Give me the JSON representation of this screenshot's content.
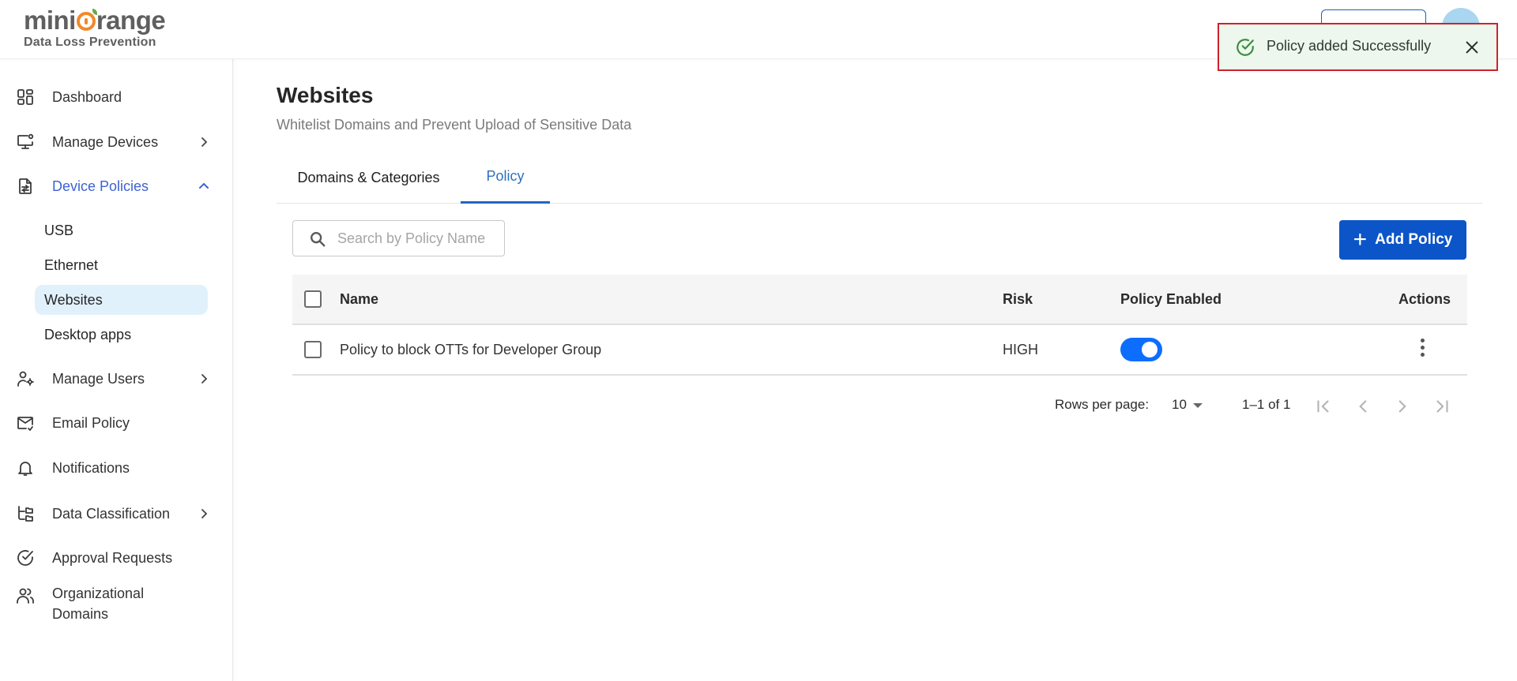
{
  "app": {
    "brand_name_pre": "mini",
    "brand_name_post": "range",
    "brand_subtitle": "Data Loss Prevention",
    "accent_color": "#0c55c8",
    "active_nav_color": "#3d63d2"
  },
  "toast": {
    "message": "Policy added Successfully",
    "icon": "check-circle-icon",
    "close_icon": "close-icon",
    "status": "success"
  },
  "sidebar": {
    "items": [
      {
        "label": "Dashboard",
        "icon": "dashboard-icon"
      },
      {
        "label": "Manage Devices",
        "icon": "monitor-icon",
        "expandable": true
      },
      {
        "label": "Device Policies",
        "icon": "policy-document-icon",
        "expanded": true,
        "active": true,
        "children": [
          {
            "label": "USB"
          },
          {
            "label": "Ethernet"
          },
          {
            "label": "Websites",
            "selected": true
          },
          {
            "label": "Desktop apps"
          }
        ]
      },
      {
        "label": "Manage Users",
        "icon": "user-settings-icon",
        "expandable": true
      },
      {
        "label": "Email Policy",
        "icon": "mail-check-icon"
      },
      {
        "label": "Notifications",
        "icon": "bell-icon"
      },
      {
        "label": "Data Classification",
        "icon": "folder-tree-icon",
        "expandable": true
      },
      {
        "label": "Approval Requests",
        "icon": "check-circle-icon"
      },
      {
        "label": "Organizational Domains",
        "label_line1": "Organizational",
        "label_line2": "Domains",
        "icon": "users-icon"
      }
    ]
  },
  "page": {
    "title": "Websites",
    "subtitle": "Whitelist Domains and Prevent Upload of Sensitive Data",
    "tabs": [
      {
        "label": "Domains & Categories",
        "active": false
      },
      {
        "label": "Policy",
        "active": true
      }
    ]
  },
  "toolbar": {
    "search_placeholder": "Search by Policy Name",
    "search_value": "",
    "add_label": "Add Policy"
  },
  "table": {
    "columns": [
      "Name",
      "Risk",
      "Policy Enabled",
      "Actions"
    ],
    "rows": [
      {
        "name": "Policy to block OTTs for Developer Group",
        "risk": "HIGH",
        "enabled": true
      }
    ]
  },
  "pagination": {
    "rows_per_page_label": "Rows per page:",
    "rows_per_page": "10",
    "range": "1–1 of 1"
  }
}
